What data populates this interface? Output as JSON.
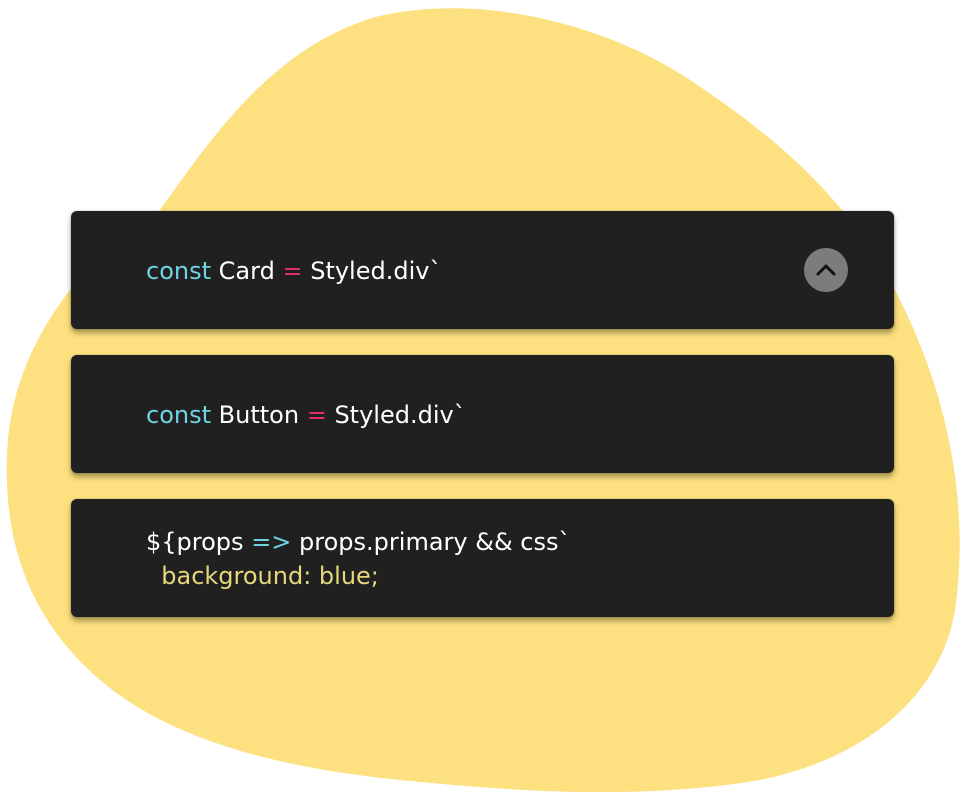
{
  "colors": {
    "blob": "#fde07f",
    "card_bg": "#202020",
    "keyword": "#6fd3e3",
    "operator": "#e0305f",
    "string": "#e6d77a",
    "text": "#ffffff",
    "button_bg": "#7c7c7c"
  },
  "cards": [
    {
      "keyword": "const",
      "name": "Card",
      "operator": "=",
      "value": "Styled.div`",
      "button_icon": "chevron-up-icon"
    },
    {
      "keyword": "const",
      "name": "Button",
      "operator": "=",
      "value": "Styled.div`"
    },
    {
      "line1_prefix": "${props",
      "arrow": "=>",
      "line1_suffix": "props.primary && css`",
      "line2": "background: blue;"
    }
  ]
}
